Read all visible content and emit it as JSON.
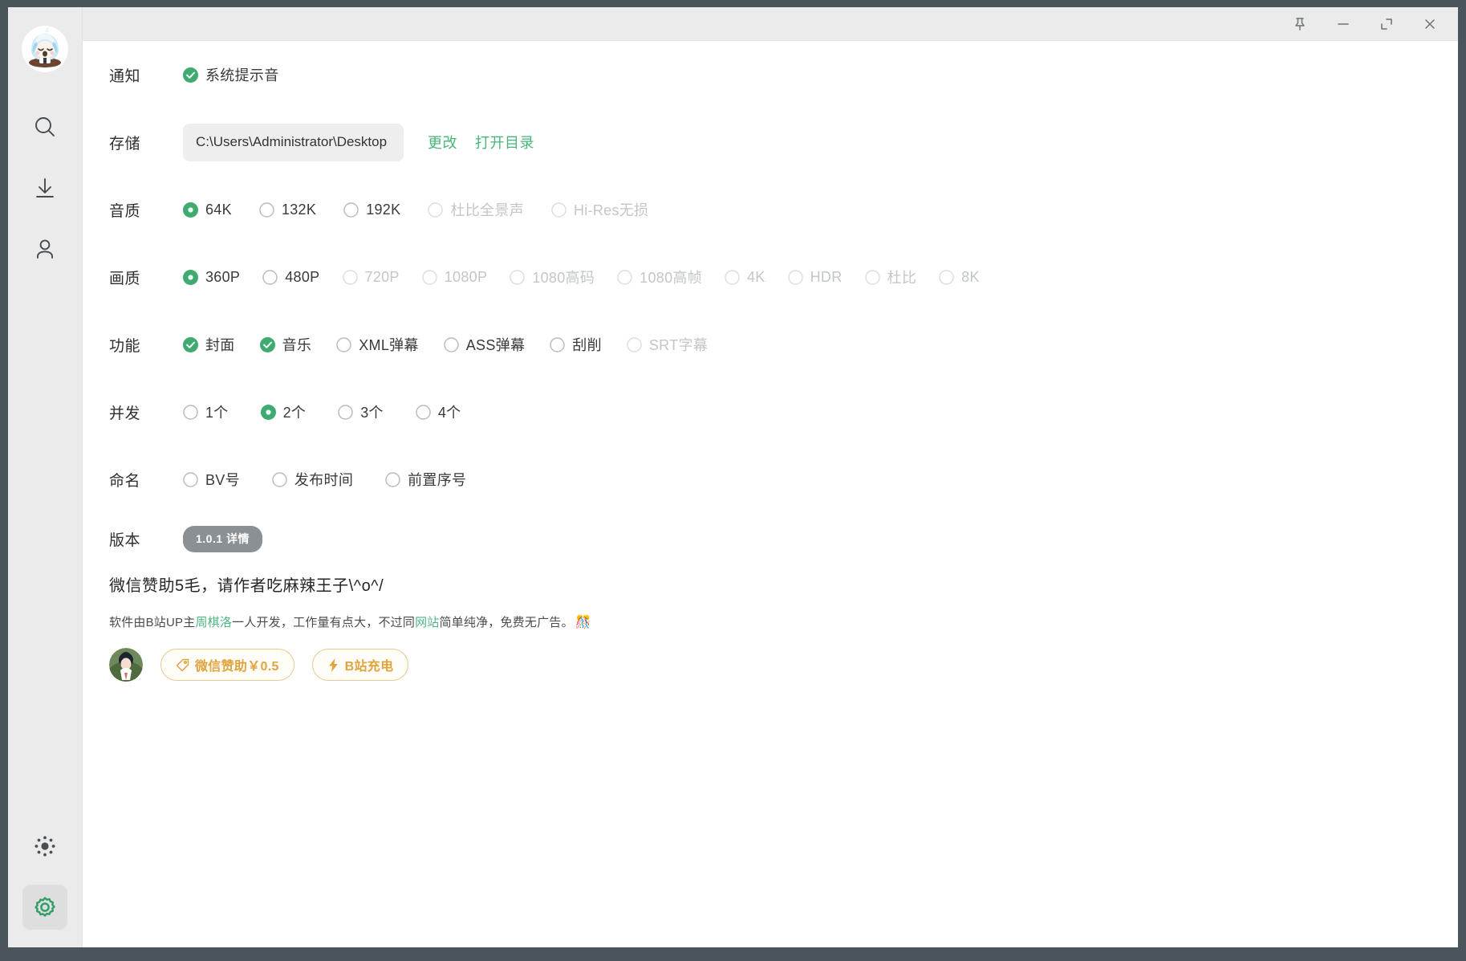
{
  "window": {
    "controls": [
      {
        "name": "pin-icon",
        "label": "置顶"
      },
      {
        "name": "minimize-icon",
        "label": "最小化"
      },
      {
        "name": "maximize-icon",
        "label": "最大化"
      },
      {
        "name": "close-icon",
        "label": "关闭"
      }
    ]
  },
  "sidebar": {
    "avatar_alt": "用户头像",
    "items": [
      {
        "name": "search-icon",
        "label": "搜索"
      },
      {
        "name": "download-icon",
        "label": "下载"
      },
      {
        "name": "user-icon",
        "label": "我的"
      }
    ],
    "bottom_items": [
      {
        "name": "theme-icon",
        "label": "主题"
      },
      {
        "name": "settings-icon",
        "label": "设置",
        "active": true
      }
    ]
  },
  "settings": {
    "notification": {
      "label": "通知",
      "options": [
        {
          "text": "系统提示音",
          "type": "checkbox",
          "checked": true,
          "disabled": false
        }
      ]
    },
    "storage": {
      "label": "存储",
      "path": "C:\\Users\\Administrator\\Desktop",
      "change_label": "更改",
      "open_label": "打开目录"
    },
    "audio_quality": {
      "label": "音质",
      "options": [
        {
          "text": "64K",
          "type": "radio",
          "checked": true,
          "disabled": false
        },
        {
          "text": "132K",
          "type": "radio",
          "checked": false,
          "disabled": false
        },
        {
          "text": "192K",
          "type": "radio",
          "checked": false,
          "disabled": false
        },
        {
          "text": "杜比全景声",
          "type": "radio",
          "checked": false,
          "disabled": true
        },
        {
          "text": "Hi-Res无损",
          "type": "radio",
          "checked": false,
          "disabled": true
        }
      ]
    },
    "video_quality": {
      "label": "画质",
      "options": [
        {
          "text": "360P",
          "type": "radio",
          "checked": true,
          "disabled": false
        },
        {
          "text": "480P",
          "type": "radio",
          "checked": false,
          "disabled": false
        },
        {
          "text": "720P",
          "type": "radio",
          "checked": false,
          "disabled": true
        },
        {
          "text": "1080P",
          "type": "radio",
          "checked": false,
          "disabled": true
        },
        {
          "text": "1080高码",
          "type": "radio",
          "checked": false,
          "disabled": true
        },
        {
          "text": "1080高帧",
          "type": "radio",
          "checked": false,
          "disabled": true
        },
        {
          "text": "4K",
          "type": "radio",
          "checked": false,
          "disabled": true
        },
        {
          "text": "HDR",
          "type": "radio",
          "checked": false,
          "disabled": true
        },
        {
          "text": "杜比",
          "type": "radio",
          "checked": false,
          "disabled": true
        },
        {
          "text": "8K",
          "type": "radio",
          "checked": false,
          "disabled": true
        }
      ]
    },
    "features": {
      "label": "功能",
      "options": [
        {
          "text": "封面",
          "type": "checkbox",
          "checked": true,
          "disabled": false
        },
        {
          "text": "音乐",
          "type": "checkbox",
          "checked": true,
          "disabled": false
        },
        {
          "text": "XML弹幕",
          "type": "checkbox",
          "checked": false,
          "disabled": false
        },
        {
          "text": "ASS弹幕",
          "type": "checkbox",
          "checked": false,
          "disabled": false
        },
        {
          "text": "刮削",
          "type": "checkbox",
          "checked": false,
          "disabled": false
        },
        {
          "text": "SRT字幕",
          "type": "checkbox",
          "checked": false,
          "disabled": true
        }
      ]
    },
    "concurrency": {
      "label": "并发",
      "options": [
        {
          "text": "1个",
          "type": "radio",
          "checked": false,
          "disabled": false
        },
        {
          "text": "2个",
          "type": "radio",
          "checked": true,
          "disabled": false
        },
        {
          "text": "3个",
          "type": "radio",
          "checked": false,
          "disabled": false
        },
        {
          "text": "4个",
          "type": "radio",
          "checked": false,
          "disabled": false
        }
      ]
    },
    "naming": {
      "label": "命名",
      "options": [
        {
          "text": "BV号",
          "type": "radio",
          "checked": false,
          "disabled": false
        },
        {
          "text": "发布时间",
          "type": "radio",
          "checked": false,
          "disabled": false
        },
        {
          "text": "前置序号",
          "type": "radio",
          "checked": false,
          "disabled": false
        }
      ]
    },
    "version": {
      "label": "版本",
      "badge": "1.0.1 详情"
    }
  },
  "sponsor": {
    "title": "微信赞助5毛，请作者吃麻辣王子\\^o^/",
    "desc_part1": "软件由B站UP主 ",
    "desc_link1": "周棋洛",
    "desc_part2": " 一人开发，工作量有点大，不过同 ",
    "desc_link2": "网站",
    "desc_part3": " 简单纯净，免费无广告。",
    "desc_emoji": "🎊",
    "wechat_button": "微信赞助￥0.5",
    "bilibili_button": "B站充电"
  },
  "colors": {
    "accent_green": "#3fab70",
    "link_green": "#49b37c",
    "orange": "#e0a33e",
    "frame": "#4a555b",
    "sidebar_bg": "#ebebeb",
    "disabled_gray": "#c3c6c8"
  }
}
